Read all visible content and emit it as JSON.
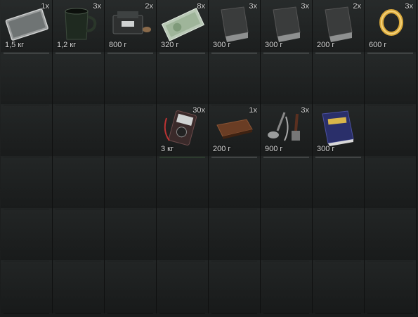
{
  "inventory": {
    "rows": [
      [
        {
          "qty": "1x",
          "weight": "1,5 кг",
          "icon": "tablet-icon"
        },
        {
          "qty": "3x",
          "weight": "1,2 кг",
          "icon": "mug-icon"
        },
        {
          "qty": "2x",
          "weight": "800 г",
          "icon": "radio-device-icon"
        },
        {
          "qty": "8x",
          "weight": "320 г",
          "icon": "banknotes-icon"
        },
        {
          "qty": "3x",
          "weight": "300 г",
          "icon": "box-icon"
        },
        {
          "qty": "3x",
          "weight": "300 г",
          "icon": "box-icon"
        },
        {
          "qty": "2x",
          "weight": "200 г",
          "icon": "box-icon"
        },
        {
          "qty": "3x",
          "weight": "600 г",
          "icon": "ring-icon"
        }
      ],
      [
        {
          "qty": "",
          "weight": "",
          "icon": ""
        },
        {
          "qty": "",
          "weight": "",
          "icon": ""
        },
        {
          "qty": "",
          "weight": "",
          "icon": ""
        },
        {
          "qty": "",
          "weight": "",
          "icon": ""
        },
        {
          "qty": "",
          "weight": "",
          "icon": ""
        },
        {
          "qty": "",
          "weight": "",
          "icon": ""
        },
        {
          "qty": "",
          "weight": "",
          "icon": ""
        },
        {
          "qty": "",
          "weight": "",
          "icon": ""
        }
      ],
      [
        {
          "qty": "",
          "weight": "",
          "icon": ""
        },
        {
          "qty": "",
          "weight": "",
          "icon": ""
        },
        {
          "qty": "",
          "weight": "",
          "icon": ""
        },
        {
          "qty": "30x",
          "weight": "3 кг",
          "icon": "multimeter-icon"
        },
        {
          "qty": "1x",
          "weight": "200 г",
          "icon": "wallet-icon"
        },
        {
          "qty": "3x",
          "weight": "900 г",
          "icon": "kitchen-utensils-icon"
        },
        {
          "qty": "",
          "weight": "300 г",
          "icon": "book-icon"
        },
        {
          "qty": "",
          "weight": "",
          "icon": ""
        }
      ],
      [
        {
          "qty": "",
          "weight": "",
          "icon": ""
        },
        {
          "qty": "",
          "weight": "",
          "icon": ""
        },
        {
          "qty": "",
          "weight": "",
          "icon": ""
        },
        {
          "qty": "",
          "weight": "",
          "icon": ""
        },
        {
          "qty": "",
          "weight": "",
          "icon": ""
        },
        {
          "qty": "",
          "weight": "",
          "icon": ""
        },
        {
          "qty": "",
          "weight": "",
          "icon": ""
        },
        {
          "qty": "",
          "weight": "",
          "icon": ""
        }
      ],
      [
        {
          "qty": "",
          "weight": "",
          "icon": ""
        },
        {
          "qty": "",
          "weight": "",
          "icon": ""
        },
        {
          "qty": "",
          "weight": "",
          "icon": ""
        },
        {
          "qty": "",
          "weight": "",
          "icon": ""
        },
        {
          "qty": "",
          "weight": "",
          "icon": ""
        },
        {
          "qty": "",
          "weight": "",
          "icon": ""
        },
        {
          "qty": "",
          "weight": "",
          "icon": ""
        },
        {
          "qty": "",
          "weight": "",
          "icon": ""
        }
      ],
      [
        {
          "qty": "",
          "weight": "",
          "icon": ""
        },
        {
          "qty": "",
          "weight": "",
          "icon": ""
        },
        {
          "qty": "",
          "weight": "",
          "icon": ""
        },
        {
          "qty": "",
          "weight": "",
          "icon": ""
        },
        {
          "qty": "",
          "weight": "",
          "icon": ""
        },
        {
          "qty": "",
          "weight": "",
          "icon": ""
        },
        {
          "qty": "",
          "weight": "",
          "icon": ""
        },
        {
          "qty": "",
          "weight": "",
          "icon": ""
        }
      ]
    ]
  },
  "colors": {
    "background": "#1c1e1e",
    "slot_line": "#b8bcbc",
    "highlight_line": "#4f8f4a",
    "text": "#d8d8d8"
  }
}
